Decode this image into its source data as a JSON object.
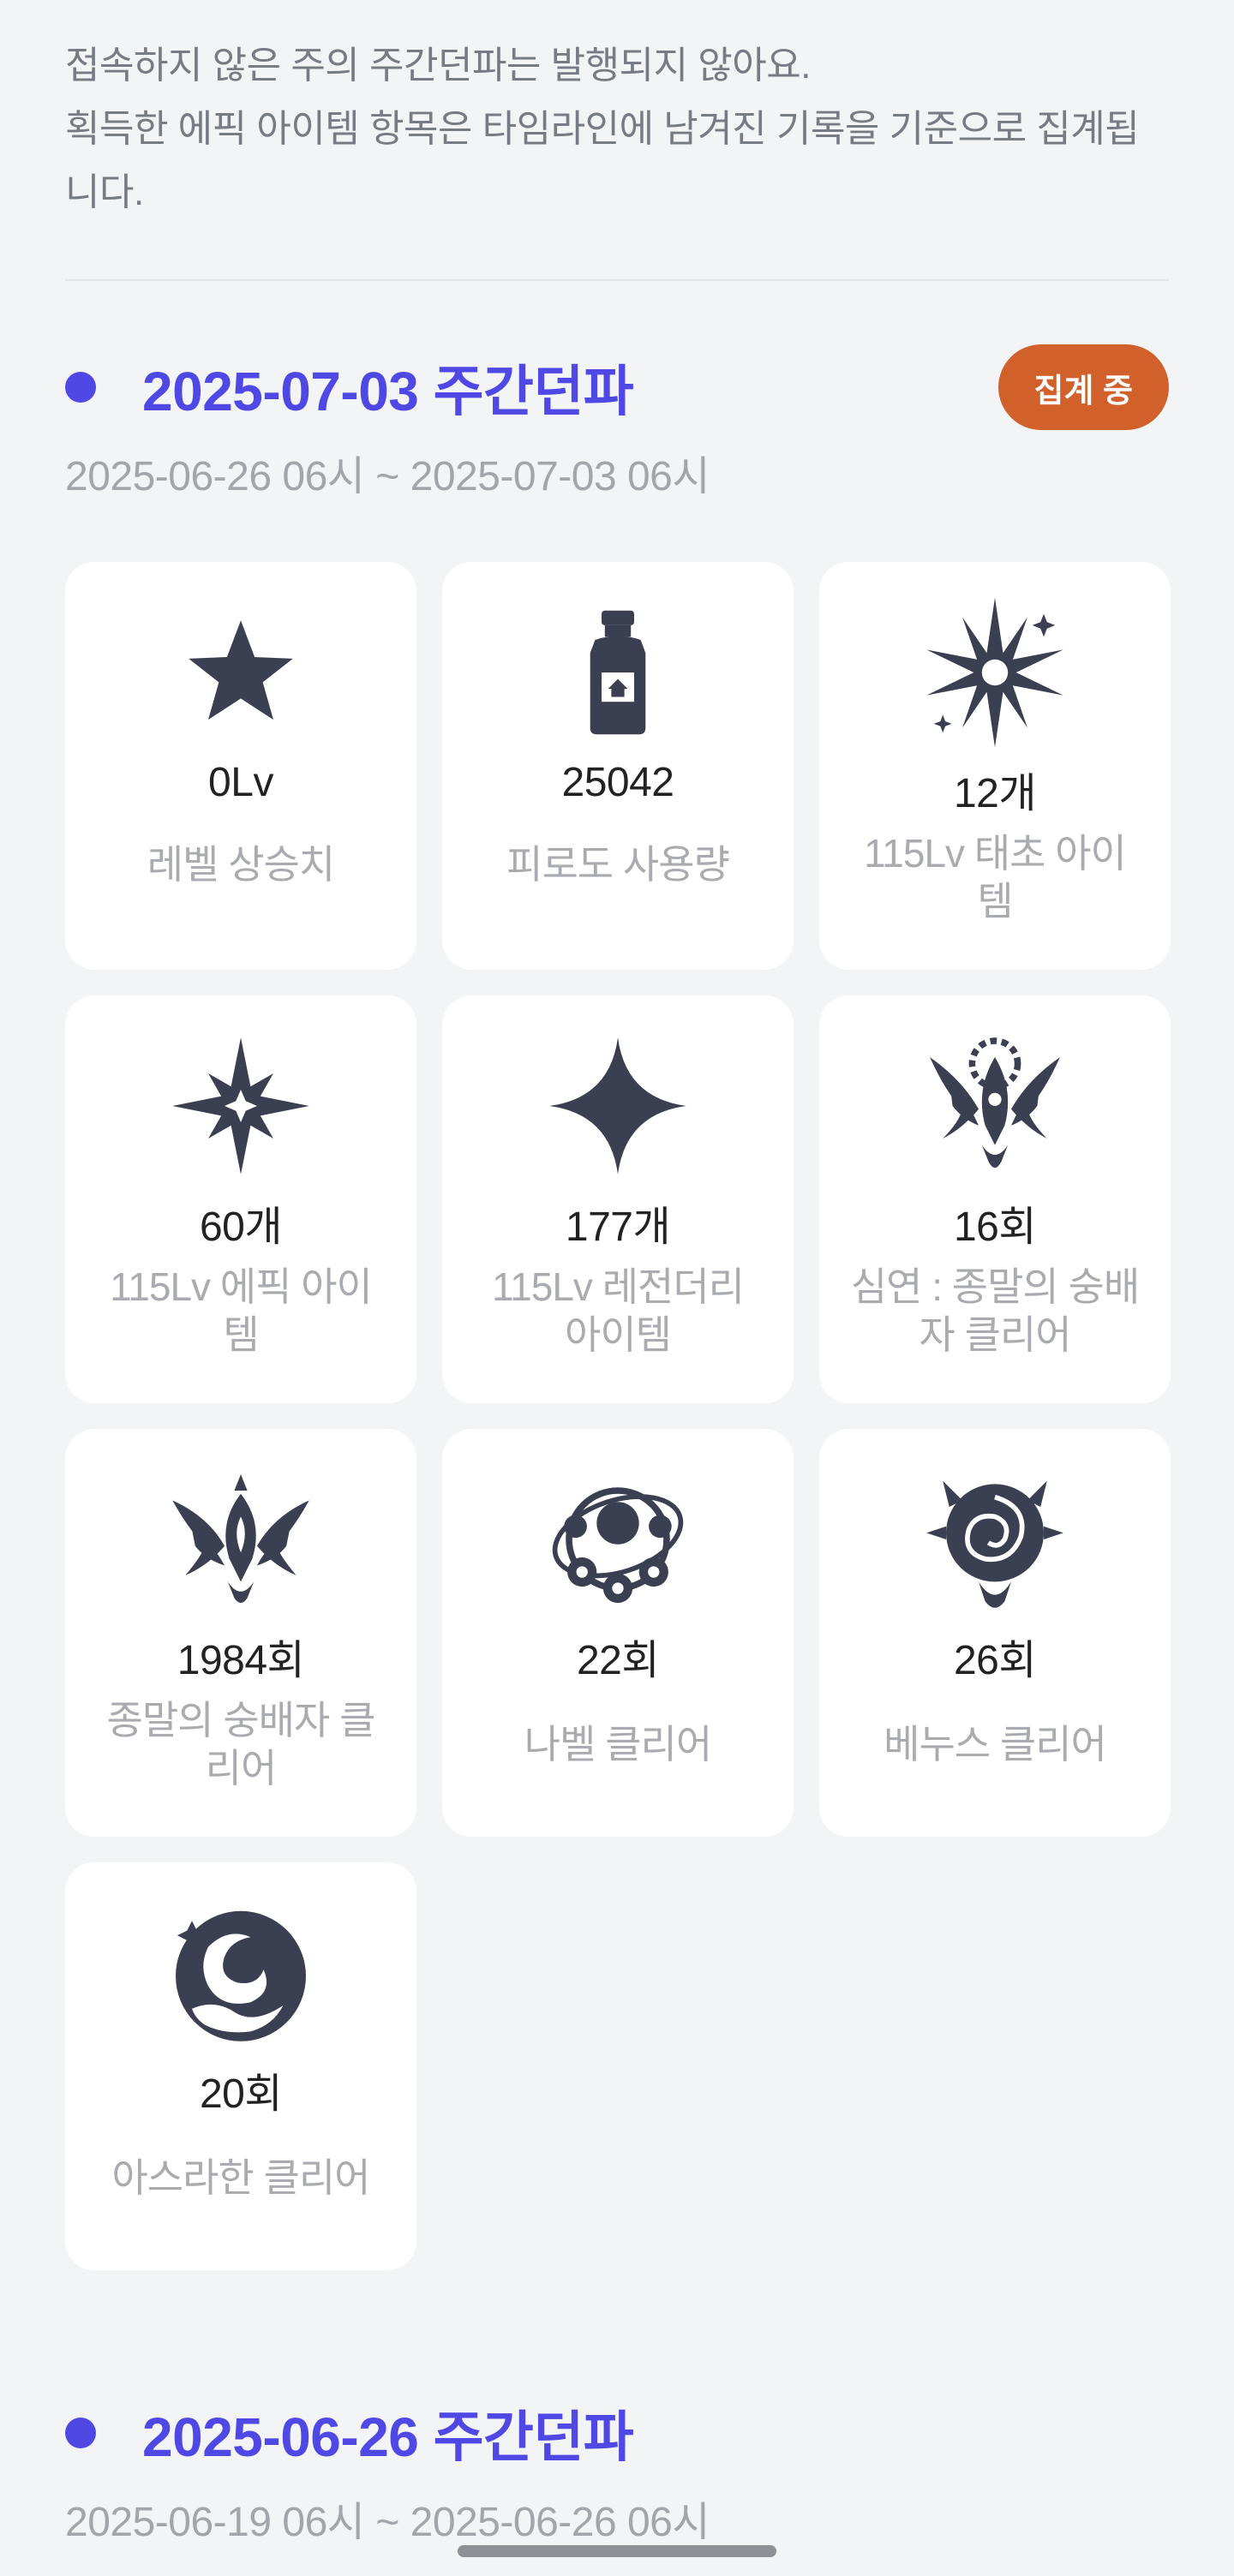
{
  "notice": {
    "line1": "접속하지 않은 주의 주간던파는 발행되지 않아요.",
    "line2": "획득한 에픽 아이템 항목은 타임라인에 남겨진 기록을 기준으로 집계됩니다."
  },
  "weeks": [
    {
      "title": "2025-07-03 주간던파",
      "range": "2025-06-26 06시 ~ 2025-07-03 06시",
      "badge": "집계 중",
      "stats": [
        {
          "icon": "star-icon",
          "value": "0Lv",
          "label": "레벨 상승치"
        },
        {
          "icon": "potion-bottle-icon",
          "value": "25042",
          "label": "피로도 사용량"
        },
        {
          "icon": "radiant-burst-icon",
          "value": "12개",
          "label": "115Lv 태초 아이템"
        },
        {
          "icon": "four-point-sparkle-icon",
          "value": "60개",
          "label": "115Lv 에픽 아이템"
        },
        {
          "icon": "four-point-star-icon",
          "value": "177개",
          "label": "115Lv 레전더리 아이템"
        },
        {
          "icon": "abyss-crest-icon",
          "value": "16회",
          "label": "심연 : 종말의 숭배자 클리어"
        },
        {
          "icon": "cultist-crest-icon",
          "value": "1984회",
          "label": "종말의 숭배자 클리어"
        },
        {
          "icon": "nabel-orb-icon",
          "value": "22회",
          "label": "나벨 클리어"
        },
        {
          "icon": "venus-rose-icon",
          "value": "26회",
          "label": "베누스 클리어"
        },
        {
          "icon": "asrahan-wave-icon",
          "value": "20회",
          "label": "아스라한 클리어"
        }
      ]
    },
    {
      "title": "2025-06-26 주간던파",
      "range": "2025-06-19 06시 ~ 2025-06-26 06시"
    }
  ],
  "colors": {
    "accent": "#5048e5",
    "badge": "#d2602b",
    "icon": "#3a3f52",
    "background": "#f3f4f6"
  }
}
